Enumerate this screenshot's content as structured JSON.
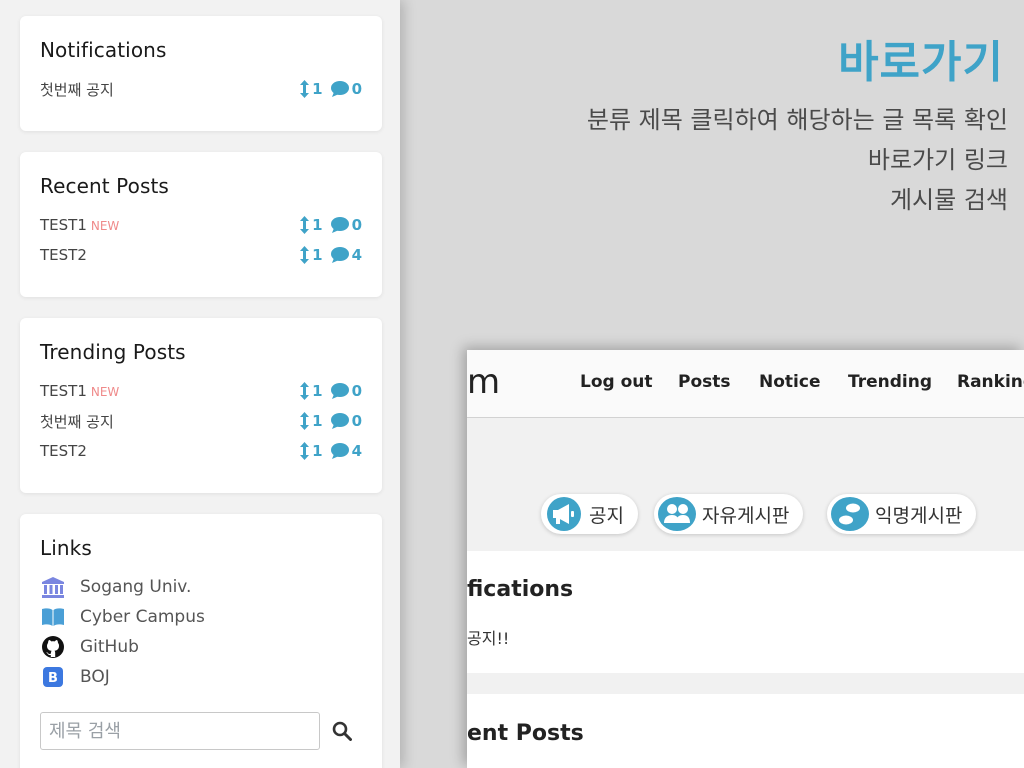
{
  "sidebar": {
    "notifications": {
      "title": "Notifications",
      "posts": [
        {
          "title": "첫번째 공지",
          "new": "",
          "votes": "1",
          "comments": "0"
        }
      ]
    },
    "recent": {
      "title": "Recent Posts",
      "posts": [
        {
          "title": "TEST1",
          "new": "NEW",
          "votes": "1",
          "comments": "0"
        },
        {
          "title": "TEST2",
          "new": "",
          "votes": "1",
          "comments": "4"
        }
      ]
    },
    "trending": {
      "title": "Trending Posts",
      "posts": [
        {
          "title": "TEST1",
          "new": "NEW",
          "votes": "1",
          "comments": "0"
        },
        {
          "title": "첫번째 공지",
          "new": "",
          "votes": "1",
          "comments": "0"
        },
        {
          "title": "TEST2",
          "new": "",
          "votes": "1",
          "comments": "4"
        }
      ]
    },
    "links": {
      "title": "Links",
      "items": [
        {
          "label": "Sogang Univ.",
          "icon": "university-icon"
        },
        {
          "label": "Cyber Campus",
          "icon": "book-icon"
        },
        {
          "label": "GitHub",
          "icon": "github-icon"
        },
        {
          "label": "BOJ",
          "icon": "boj-icon"
        }
      ]
    },
    "search": {
      "placeholder": "제목 검색",
      "value": ""
    }
  },
  "annotation": {
    "headline": "바로가기",
    "lines": [
      "분류 제목 클릭하여 해당하는 글 목록 확인",
      "바로가기 링크",
      "게시물 검색"
    ]
  },
  "screenshot": {
    "logo": "m",
    "nav": [
      "Log out",
      "Posts",
      "Notice",
      "Trending",
      "Ranking"
    ],
    "boards": [
      {
        "label": "공지",
        "icon": "megaphone-icon"
      },
      {
        "label": "자유게시판",
        "icon": "users-icon"
      },
      {
        "label": "익명게시판",
        "icon": "footprints-icon"
      }
    ],
    "notifications_title": "fications",
    "notifications_text": "공지!!",
    "recent_title": "ent Posts"
  },
  "colors": {
    "accent": "#3fa3c8",
    "new_badge": "#ef8a8a",
    "background": "#d9d9d9",
    "sidebar": "#f2f2f2"
  }
}
